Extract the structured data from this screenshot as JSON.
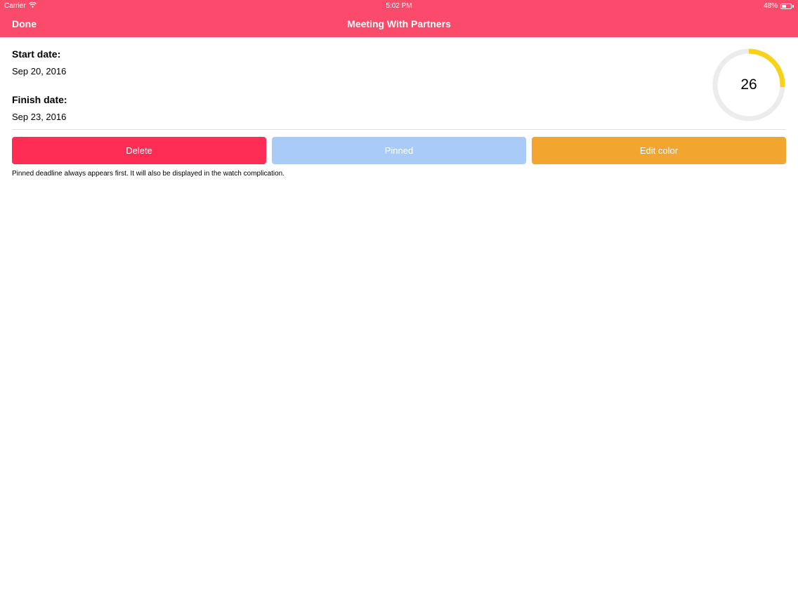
{
  "status_bar": {
    "carrier": "Carrier",
    "time": "5:02 PM",
    "battery": "48%",
    "battery_level": 0.48
  },
  "nav": {
    "done_label": "Done",
    "title": "Meeting With Partners"
  },
  "details": {
    "start_label": "Start date:",
    "start_value": "Sep 20, 2016",
    "finish_label": "Finish date:",
    "finish_value": "Sep 23, 2016"
  },
  "progress_ring": {
    "value": "26",
    "fraction": 0.26,
    "track_color": "#ececec",
    "fill_color": "#f7d21d"
  },
  "actions": {
    "delete_label": "Delete",
    "pinned_label": "Pinned",
    "edit_color_label": "Edit color"
  },
  "colors": {
    "header": "#fb4b6b",
    "delete": "#fd2d56",
    "pinned": "#a9cbf7",
    "edit_color": "#f2a52f"
  },
  "note": "Pinned deadline always appears first. It will also be displayed in the watch complication."
}
